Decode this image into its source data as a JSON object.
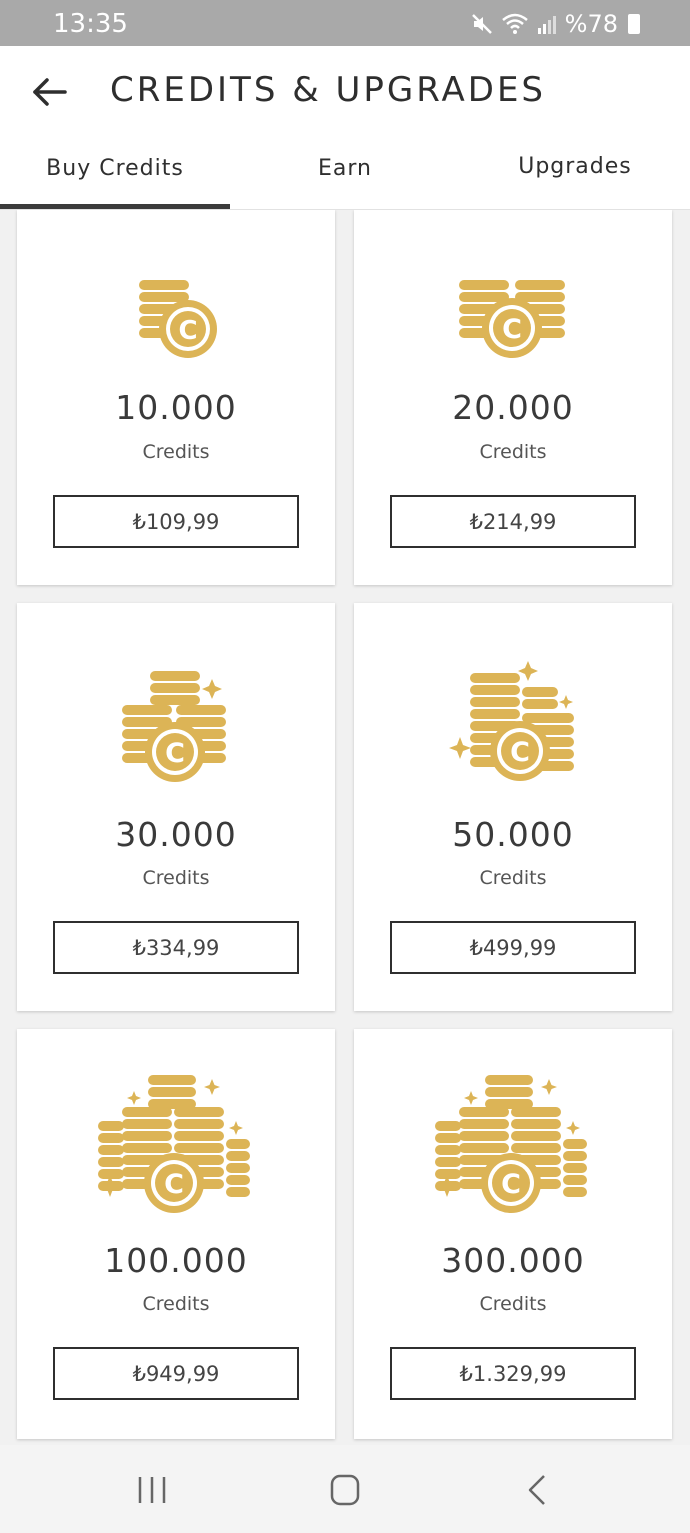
{
  "status_bar": {
    "time": "13:35",
    "battery": "%78"
  },
  "header": {
    "title": "CREDITS & UPGRADES"
  },
  "tabs": [
    {
      "label": "Buy Credits",
      "active": true
    },
    {
      "label": "Earn",
      "active": false
    },
    {
      "label": "Upgrades",
      "active": false
    }
  ],
  "accent_color": "#dcb456",
  "packages": [
    {
      "amount": "10.000",
      "unit": "Credits",
      "price": "₺109,99",
      "icon": "coin-stacks-small-icon"
    },
    {
      "amount": "20.000",
      "unit": "Credits",
      "price": "₺214,99",
      "icon": "coin-stacks-double-icon"
    },
    {
      "amount": "30.000",
      "unit": "Credits",
      "price": "₺334,99",
      "icon": "coin-stacks-sparkle-icon"
    },
    {
      "amount": "50.000",
      "unit": "Credits",
      "price": "₺499,99",
      "icon": "coin-stacks-sparkle-large-icon"
    },
    {
      "amount": "100.000",
      "unit": "Credits",
      "price": "₺949,99",
      "icon": "coin-pile-icon"
    },
    {
      "amount": "300.000",
      "unit": "Credits",
      "price": "₺1.329,99",
      "icon": "coin-pile-large-icon"
    }
  ],
  "nav": {
    "recents": "recents-icon",
    "home": "home-icon",
    "back": "back-icon"
  }
}
